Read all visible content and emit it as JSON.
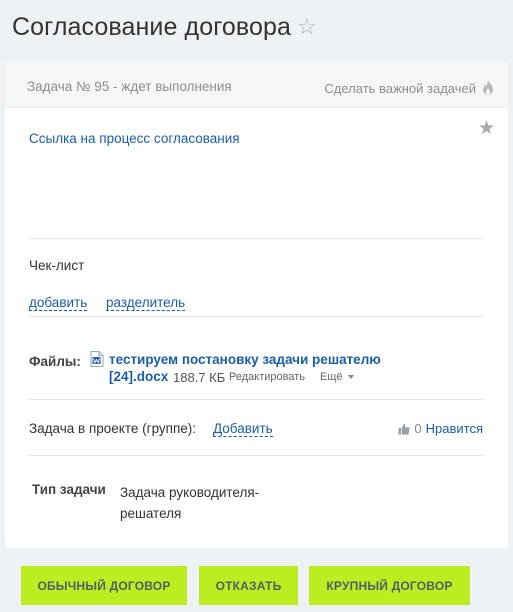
{
  "page": {
    "title": "Согласование договора",
    "title_star": "☆"
  },
  "task": {
    "status": "Задача № 95 - ждет выполнения",
    "make_important": "Сделать важной задачей",
    "favorite_star": "★",
    "process_link": "Ссылка на процесс согласования"
  },
  "checklist": {
    "title": "Чек-лист",
    "add": "добавить",
    "separator": "разделитель"
  },
  "files": {
    "label": "Файлы:",
    "items": [
      {
        "name_line1": "тестируем постановку задачи решателю",
        "name_line2": "[24].docx",
        "size": "188.7 КБ",
        "edit": "Редактировать",
        "more": "Ещё"
      }
    ]
  },
  "project": {
    "label": "Задача в проекте (группе):",
    "add": "Добавить",
    "like_count": "0",
    "like_text": "Нравится"
  },
  "task_type": {
    "label": "Тип задачи",
    "value": "Задача руководителя-решателя"
  },
  "actions": {
    "regular": "Обычный договор",
    "reject": "Отказать",
    "large": "Крупный договор"
  },
  "colors": {
    "accent_button": "#bbed21",
    "link": "#1a5ea8",
    "background": "#eef2f4"
  },
  "icons": {
    "flame": "flame-icon",
    "document": "docx-file-icon",
    "like": "thumbs-up-icon"
  }
}
